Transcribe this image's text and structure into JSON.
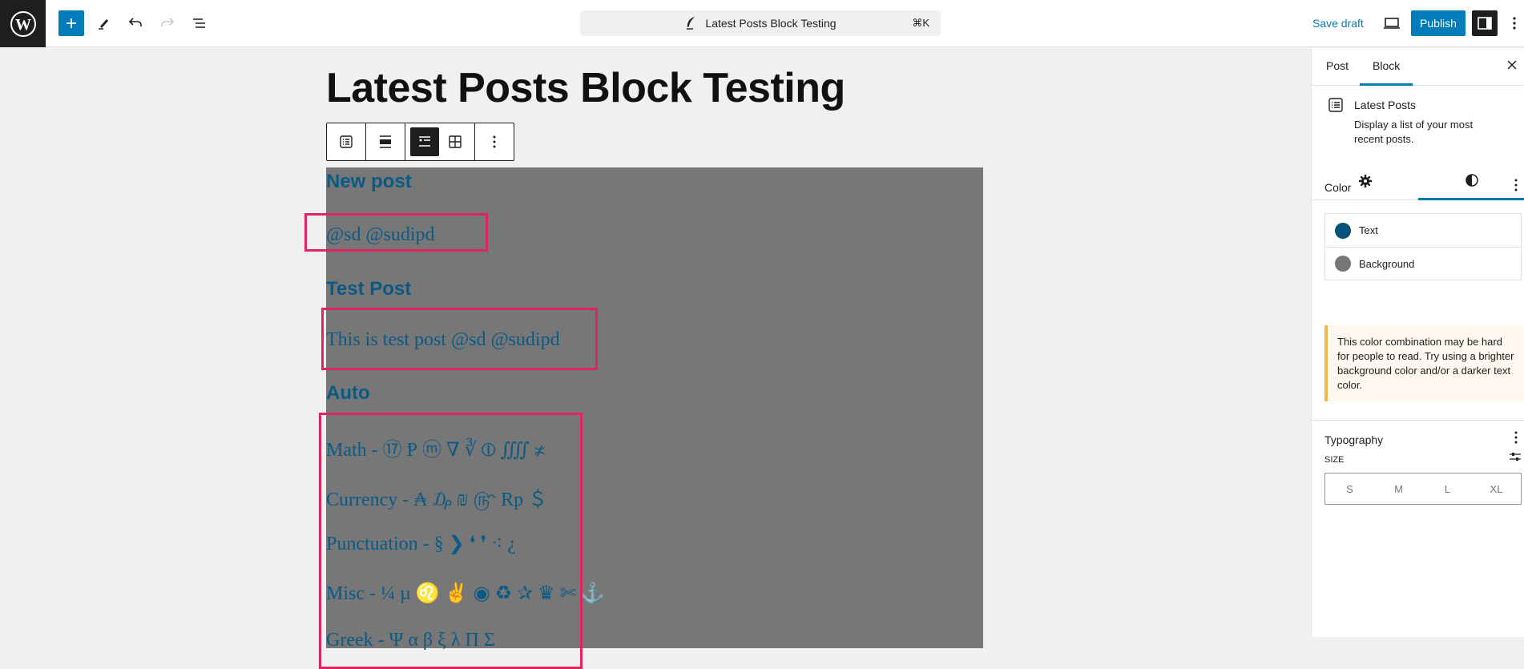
{
  "header": {
    "command_bar_title": "Latest Posts Block Testing",
    "command_shortcut": "⌘K",
    "save_draft": "Save draft",
    "publish": "Publish"
  },
  "editor": {
    "post_title": "Latest Posts Block Testing",
    "latest_posts": [
      {
        "title": "New post",
        "excerpt": "@sd @sudipd"
      },
      {
        "title": "Test Post",
        "excerpt": "This is test post @sd @sudipd"
      },
      {
        "title": "Auto",
        "excerpt_lines": [
          "Math - ⑰ Ᵽ ⓜ ∇ ∛ ⦶ ⨌ ≭",
          "Currency - ₳ ₯ ₪ ௹ Rp ＄",
          "Punctuation - § ❯ ❛ ❜ ⁖ ¿",
          "Misc - ¼ µ ♌ ✌ ◉ ♻ ✰ ♛ ✄ ⚓",
          "Greek - Ψ α β ξ λ Π Σ"
        ]
      }
    ],
    "colors": {
      "post_text": "#0a5a85",
      "block_background": "#777777",
      "highlight": "#e0245e"
    }
  },
  "sidebar": {
    "tabs": [
      "Post",
      "Block"
    ],
    "active_tab": "Block",
    "block_name": "Latest Posts",
    "block_description": "Display a list of your most recent posts.",
    "color_panel": {
      "title": "Color",
      "items": [
        {
          "label": "Text",
          "color": "#04527a"
        },
        {
          "label": "Background",
          "color": "#777777"
        }
      ],
      "notice": "This color combination may be hard for people to read. Try using a brighter background color and/or a darker text color."
    },
    "typography_panel": {
      "title": "Typography",
      "size_label": "SIZE",
      "sizes": [
        "S",
        "M",
        "L",
        "XL"
      ]
    }
  }
}
